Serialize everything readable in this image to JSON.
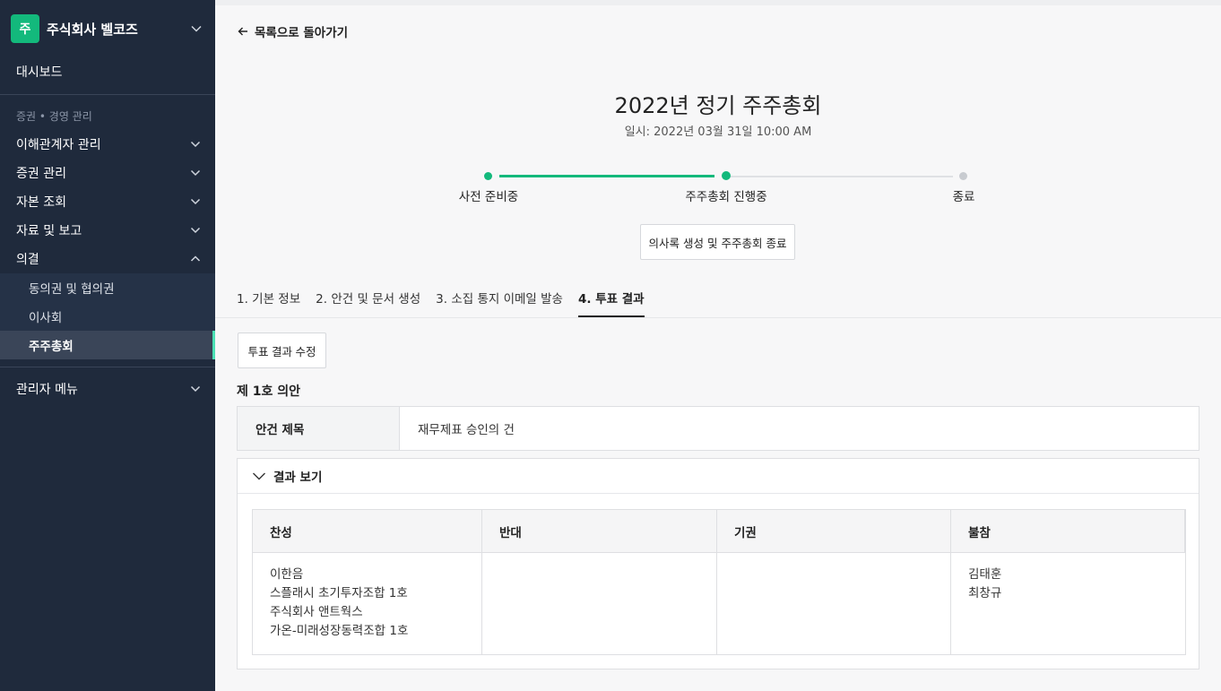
{
  "sidebar": {
    "company_initial": "주",
    "company_name": "주식회사 벨코즈",
    "dashboard": "대시보드",
    "section_label": "증권 • 경영 관리",
    "items": [
      {
        "label": "이해관계자 관리"
      },
      {
        "label": "증권 관리"
      },
      {
        "label": "자본 조회"
      },
      {
        "label": "자료 및 보고"
      },
      {
        "label": "의결"
      }
    ],
    "sub_items": [
      {
        "label": "동의권 및 협의권"
      },
      {
        "label": "이사회"
      },
      {
        "label": "주주총회"
      }
    ],
    "admin_menu": "관리자 메뉴"
  },
  "main": {
    "back_label": "목록으로 돌아가기",
    "title": "2022년 정기 주주총회",
    "subtitle": "일시: 2022년 03월 31일 10:00 AM",
    "steps": [
      {
        "label": "사전 준비중"
      },
      {
        "label": "주주총회 진행중"
      },
      {
        "label": "종료"
      }
    ],
    "end_button": "의사록 생성 및 주주총회 종료",
    "tabs": [
      {
        "label": "1. 기본 정보"
      },
      {
        "label": "2. 안건 및 문서 생성"
      },
      {
        "label": "3. 소집 통지 이메일 발송"
      },
      {
        "label": "4. 투표 결과"
      }
    ],
    "edit_button": "투표 결과 수정",
    "agenda_heading": "제 1호 의안",
    "agenda_title_key": "안건 제목",
    "agenda_title_value": "재무제표 승인의 건",
    "result_toggle": "결과 보기",
    "vote_table": {
      "headers": [
        "찬성",
        "반대",
        "기권",
        "불참"
      ],
      "for": [
        "이한음",
        "스플래시 초기투자조합 1호",
        "주식회사 앤트웍스",
        "가온-미래성장동력조합 1호"
      ],
      "against": [],
      "abstain": [],
      "absent": [
        "김태훈",
        "최창규"
      ]
    }
  },
  "colors": {
    "sidebar_bg": "#1f2a3c",
    "accent": "#13b97c",
    "active_marker": "#4be1b5"
  }
}
